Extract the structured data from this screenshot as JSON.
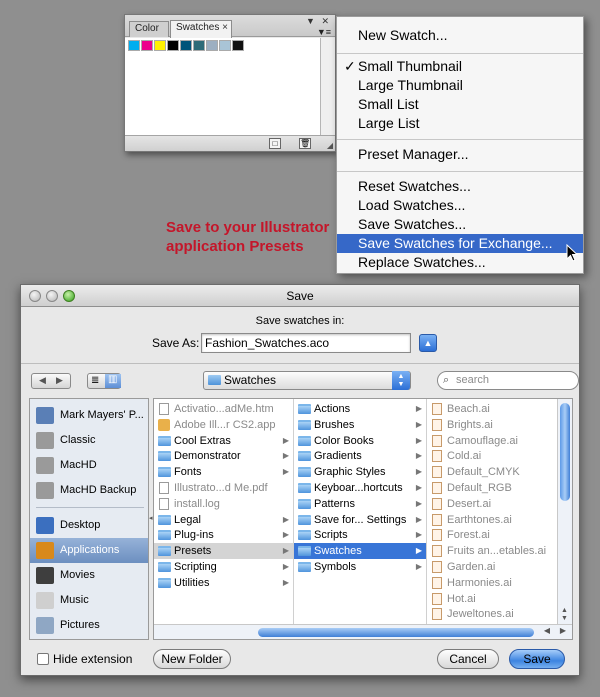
{
  "panel": {
    "tabs": [
      "Color",
      "Swatches"
    ],
    "tab_close": "×",
    "controls": "▼ ✕",
    "menu_button": "▼≡",
    "swatch_colors": [
      "#00aeef",
      "#ec008c",
      "#fff200",
      "#000000",
      "#00547a",
      "#2e6b78",
      "#9dafc1",
      "#a9c4d6",
      "#111111"
    ],
    "footer_new": "□",
    "footer_delete": "🗑"
  },
  "menu": {
    "new_swatch": "New Swatch...",
    "small_thumbnail": "Small Thumbnail",
    "checkmark": "✓",
    "large_thumbnail": "Large Thumbnail",
    "small_list": "Small List",
    "large_list": "Large List",
    "preset_manager": "Preset Manager...",
    "reset_swatches": "Reset Swatches...",
    "load_swatches": "Load Swatches...",
    "save_swatches": "Save Swatches...",
    "save_for_exchange": "Save Swatches for Exchange...",
    "replace_swatches": "Replace Swatches..."
  },
  "annotation": {
    "line1": "Save to your Illustrator",
    "line2": "application Presets",
    "color": "#c4162a"
  },
  "dialog": {
    "title": "Save",
    "save_in_label": "Save swatches in:",
    "save_as_label": "Save As:",
    "filename": "Fashion_Swatches.aco",
    "current_folder": "Swatches",
    "search_placeholder": "search",
    "hide_extension": "Hide extension",
    "new_folder": "New Folder",
    "cancel": "Cancel",
    "save": "Save",
    "sidebar": [
      {
        "label": "Mark Mayers' P...",
        "icon": "computer-icon"
      },
      {
        "label": "Classic",
        "icon": "drive-icon"
      },
      {
        "label": "MacHD",
        "icon": "drive-icon"
      },
      {
        "label": "MacHD Backup",
        "icon": "drive-icon"
      },
      {
        "label": "Desktop",
        "icon": "desktop-icon"
      },
      {
        "label": "Applications",
        "icon": "applications-icon"
      },
      {
        "label": "Movies",
        "icon": "movies-icon"
      },
      {
        "label": "Music",
        "icon": "music-icon"
      },
      {
        "label": "Pictures",
        "icon": "pictures-icon"
      }
    ],
    "column1": [
      {
        "label": "Activatio...adMe.htm",
        "kind": "doc",
        "dim": true
      },
      {
        "label": "Adobe Ill...r CS2.app",
        "kind": "app",
        "dim": true
      },
      {
        "label": "Cool Extras",
        "kind": "folder",
        "arrow": true
      },
      {
        "label": "Demonstrator",
        "kind": "folder",
        "arrow": true
      },
      {
        "label": "Fonts",
        "kind": "folder",
        "arrow": true
      },
      {
        "label": "Illustrato...d Me.pdf",
        "kind": "doc",
        "dim": true
      },
      {
        "label": "install.log",
        "kind": "doc",
        "dim": true
      },
      {
        "label": "Legal",
        "kind": "folder",
        "arrow": true
      },
      {
        "label": "Plug-ins",
        "kind": "folder",
        "arrow": true
      },
      {
        "label": "Presets",
        "kind": "folder",
        "arrow": true,
        "selected": "grey"
      },
      {
        "label": "Scripting",
        "kind": "folder",
        "arrow": true
      },
      {
        "label": "Utilities",
        "kind": "folder",
        "arrow": true
      }
    ],
    "column2": [
      {
        "label": "Actions",
        "kind": "folder",
        "arrow": true
      },
      {
        "label": "Brushes",
        "kind": "folder",
        "arrow": true
      },
      {
        "label": "Color Books",
        "kind": "folder",
        "arrow": true
      },
      {
        "label": "Gradients",
        "kind": "folder",
        "arrow": true
      },
      {
        "label": "Graphic Styles",
        "kind": "folder",
        "arrow": true
      },
      {
        "label": "Keyboar...hortcuts",
        "kind": "folder",
        "arrow": true
      },
      {
        "label": "Patterns",
        "kind": "folder",
        "arrow": true
      },
      {
        "label": "Save for... Settings",
        "kind": "folder",
        "arrow": true
      },
      {
        "label": "Scripts",
        "kind": "folder",
        "arrow": true
      },
      {
        "label": "Swatches",
        "kind": "folder",
        "arrow": true,
        "selected": "blue"
      },
      {
        "label": "Symbols",
        "kind": "folder",
        "arrow": true
      }
    ],
    "column3": [
      {
        "label": "Beach.ai",
        "kind": "ai",
        "dim": true
      },
      {
        "label": "Brights.ai",
        "kind": "ai",
        "dim": true
      },
      {
        "label": "Camouflage.ai",
        "kind": "ai",
        "dim": true
      },
      {
        "label": "Cold.ai",
        "kind": "ai",
        "dim": true
      },
      {
        "label": "Default_CMYK",
        "kind": "ai",
        "dim": true
      },
      {
        "label": "Default_RGB",
        "kind": "ai",
        "dim": true
      },
      {
        "label": "Desert.ai",
        "kind": "ai",
        "dim": true
      },
      {
        "label": "Earthtones.ai",
        "kind": "ai",
        "dim": true
      },
      {
        "label": "Forest.ai",
        "kind": "ai",
        "dim": true
      },
      {
        "label": "Fruits an...etables.ai",
        "kind": "ai",
        "dim": true
      },
      {
        "label": "Garden.ai",
        "kind": "ai",
        "dim": true
      },
      {
        "label": "Harmonies.ai",
        "kind": "ai",
        "dim": true
      },
      {
        "label": "Hot.ai",
        "kind": "ai",
        "dim": true
      },
      {
        "label": "Jeweltones.ai",
        "kind": "ai",
        "dim": true
      }
    ]
  },
  "colors": {
    "accent": "#3668c8",
    "selection": "#3875d7"
  }
}
